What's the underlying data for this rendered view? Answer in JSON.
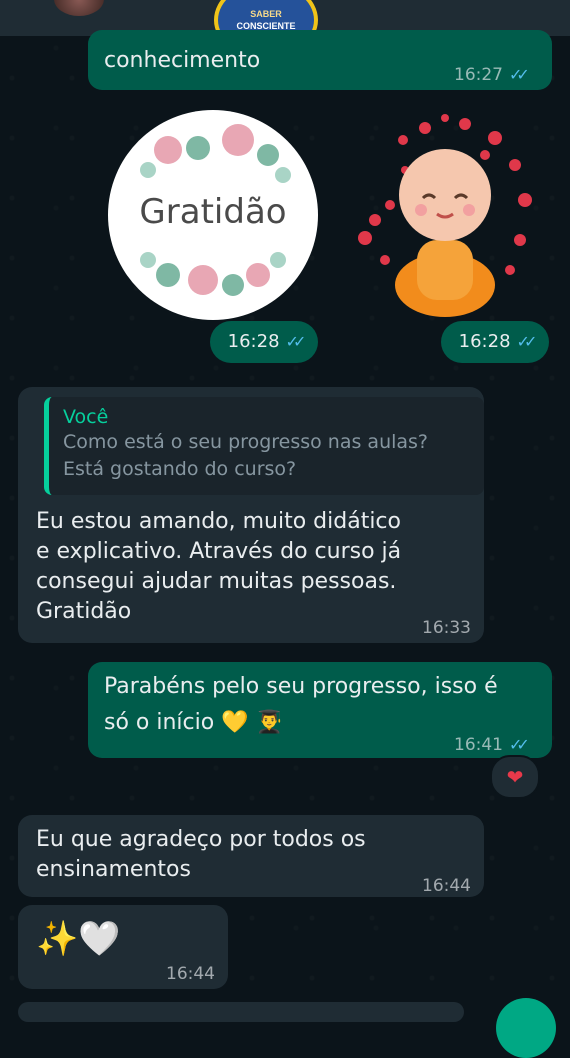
{
  "header": {
    "logo_line1": "SABER",
    "logo_line2": "CONSCIENTE"
  },
  "messages": {
    "m1": {
      "text": "conhecimento",
      "time": "16:27",
      "status": "✓✓"
    },
    "sticker1": {
      "text": "Gratidão",
      "time": "16:28",
      "status": "✓✓"
    },
    "sticker2": {
      "time": "16:28",
      "status": "✓✓"
    },
    "m2": {
      "quote_author": "Você",
      "quote_line1": "Como está o seu progresso nas aulas?",
      "quote_line2": "Está gostando do curso?",
      "line1": "Eu estou amando, muito didático",
      "line2": "e explicativo. Através do curso já",
      "line3": "consegui ajudar muitas pessoas.",
      "line4": "Gratidão",
      "time": "16:33"
    },
    "m3": {
      "line1": "Parabéns pelo seu progresso, isso é",
      "line2": "só o início 💛 👨‍🎓",
      "time": "16:41",
      "status": "✓✓",
      "reaction": "❤"
    },
    "m4": {
      "line1": "Eu que agradeço por todos os",
      "line2": "ensinamentos",
      "time": "16:44"
    },
    "m5": {
      "text": "✨🤍",
      "time": "16:44"
    }
  },
  "colors": {
    "outgoing": "#005c4b",
    "incoming": "#1f2c34",
    "read_ticks": "#53bdeb",
    "quote_bar": "#06cf9c"
  }
}
